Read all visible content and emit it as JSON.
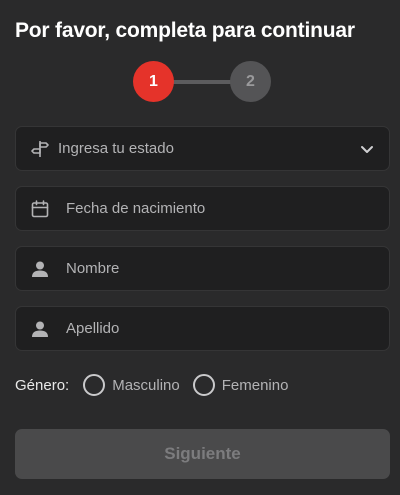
{
  "header": {
    "title": "Por favor, completa para continuar"
  },
  "stepper": {
    "steps": [
      "1",
      "2"
    ],
    "current_step": 1,
    "colors": {
      "active": "#e5332a",
      "inactive": "#545456"
    }
  },
  "form": {
    "state": {
      "placeholder": "Ingresa tu estado",
      "icon": "signpost-icon"
    },
    "birthdate": {
      "placeholder": "Fecha de nacimiento",
      "icon": "calendar-icon"
    },
    "first_name": {
      "placeholder": "Nombre",
      "icon": "user-icon"
    },
    "last_name": {
      "placeholder": "Apellido",
      "icon": "user-icon"
    },
    "gender": {
      "label": "Género:",
      "options": [
        "Masculino",
        "Femenino"
      ],
      "selected": null
    },
    "submit_label": "Siguiente"
  }
}
